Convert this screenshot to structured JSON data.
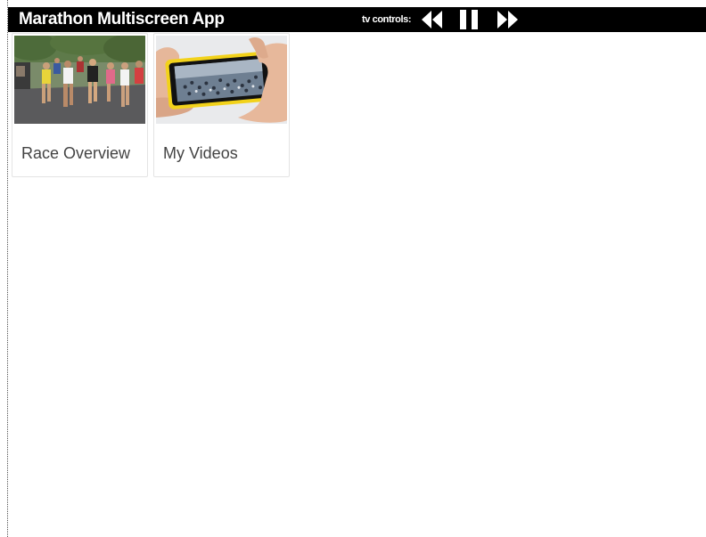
{
  "app": {
    "title": "Marathon Multiscreen App"
  },
  "tv_controls": {
    "label": "tv controls:",
    "rewind_icon": "rewind-icon",
    "pause_icon": "pause-icon",
    "fast_forward_icon": "fast-forward-icon"
  },
  "tiles": [
    {
      "label": "Race Overview",
      "image": "marathon-runners-photo"
    },
    {
      "label": "My Videos",
      "image": "hands-holding-phone-photo"
    }
  ],
  "colors": {
    "topbar_bg": "#000000",
    "topbar_text": "#ffffff",
    "tile_label": "#444444",
    "tile_border": "#e4e4e4"
  }
}
